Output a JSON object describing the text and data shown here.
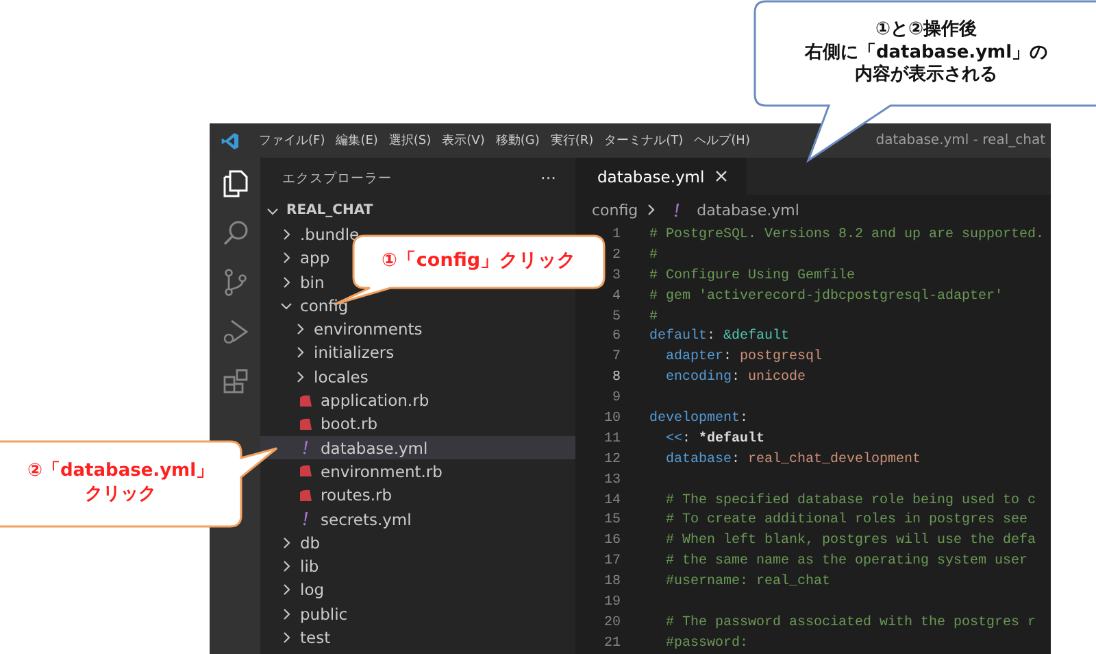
{
  "callouts": [
    {
      "kind": "red",
      "lines": [
        "①「config」クリック"
      ]
    },
    {
      "kind": "orange",
      "lines": [
        "②「database.yml」",
        "クリック"
      ]
    },
    {
      "kind": "blue",
      "lines": [
        "①と②操作後",
        "右側に「database.yml」の",
        "内容が表示される"
      ]
    }
  ],
  "window": {
    "menu": [
      "ファイル(F)",
      "編集(E)",
      "選択(S)",
      "表示(V)",
      "移動(G)",
      "実行(R)",
      "ターミナル(T)",
      "ヘルプ(H)"
    ],
    "title": "database.yml - real_chat"
  },
  "sidebar": {
    "title": "エクスプローラー",
    "more": "···",
    "root": {
      "label": "REAL_CHAT",
      "expanded": true
    },
    "items": [
      {
        "kind": "folder",
        "label": ".bundle",
        "expanded": false,
        "selected": false
      },
      {
        "kind": "folder",
        "label": "app",
        "expanded": false,
        "selected": false
      },
      {
        "kind": "folder",
        "label": "bin",
        "expanded": false,
        "selected": false
      },
      {
        "kind": "folder",
        "label": "config",
        "expanded": true,
        "selected": false,
        "children": [
          {
            "kind": "folder",
            "label": "environments",
            "expanded": false,
            "selected": false
          },
          {
            "kind": "folder",
            "label": "initializers",
            "expanded": false,
            "selected": false
          },
          {
            "kind": "folder",
            "label": "locales",
            "expanded": false,
            "selected": false
          },
          {
            "kind": "ruby",
            "label": "application.rb",
            "selected": false
          },
          {
            "kind": "ruby",
            "label": "boot.rb",
            "selected": false
          },
          {
            "kind": "yaml",
            "label": "database.yml",
            "selected": true
          },
          {
            "kind": "ruby",
            "label": "environment.rb",
            "selected": false
          },
          {
            "kind": "ruby",
            "label": "routes.rb",
            "selected": false
          },
          {
            "kind": "yaml",
            "label": "secrets.yml",
            "selected": false
          }
        ]
      },
      {
        "kind": "folder",
        "label": "db",
        "expanded": false,
        "selected": false
      },
      {
        "kind": "folder",
        "label": "lib",
        "expanded": false,
        "selected": false
      },
      {
        "kind": "folder",
        "label": "log",
        "expanded": false,
        "selected": false
      },
      {
        "kind": "folder",
        "label": "public",
        "expanded": false,
        "selected": false
      },
      {
        "kind": "folder",
        "label": "test",
        "expanded": false,
        "selected": false
      }
    ]
  },
  "editor": {
    "tabs": [
      {
        "label": "database.yml",
        "selected": true
      }
    ],
    "breadcrumb": [
      "config",
      "database.yml"
    ],
    "lines": [
      {
        "number": "1",
        "active": false,
        "tokens": [
          {
            "kind": "comment",
            "text": "# PostgreSQL. Versions 8.2 and up are supported."
          }
        ]
      },
      {
        "number": "2",
        "active": false,
        "tokens": [
          {
            "kind": "comment",
            "text": "#"
          }
        ]
      },
      {
        "number": "3",
        "active": false,
        "tokens": [
          {
            "kind": "comment",
            "text": "# Configure Using Gemfile"
          }
        ]
      },
      {
        "number": "4",
        "active": false,
        "tokens": [
          {
            "kind": "comment",
            "text": "# gem 'activerecord-jdbcpostgresql-adapter'"
          }
        ]
      },
      {
        "number": "5",
        "active": false,
        "tokens": [
          {
            "kind": "comment",
            "text": "#"
          }
        ]
      },
      {
        "number": "6",
        "active": false,
        "tokens": [
          {
            "kind": "key",
            "text": "default"
          },
          {
            "kind": "plain",
            "text": ": "
          },
          {
            "kind": "anchor",
            "text": "&default"
          }
        ]
      },
      {
        "number": "7",
        "active": false,
        "tokens": [
          {
            "kind": "key",
            "text": "  adapter"
          },
          {
            "kind": "plain",
            "text": ": "
          },
          {
            "kind": "value",
            "text": "postgresql"
          }
        ]
      },
      {
        "number": "8",
        "active": true,
        "tokens": [
          {
            "kind": "key",
            "text": "  encoding"
          },
          {
            "kind": "plain",
            "text": ": "
          },
          {
            "kind": "value",
            "text": "unicode"
          }
        ]
      },
      {
        "number": "9",
        "active": false
      },
      {
        "number": "10",
        "active": false,
        "tokens": [
          {
            "kind": "key",
            "text": "development"
          },
          {
            "kind": "plain",
            "text": ":"
          }
        ]
      },
      {
        "number": "11",
        "active": false,
        "tokens": [
          {
            "kind": "key",
            "text": "  <<"
          },
          {
            "kind": "plain",
            "text": ": "
          },
          {
            "kind": "alias",
            "text": "*default"
          }
        ]
      },
      {
        "number": "12",
        "active": false,
        "tokens": [
          {
            "kind": "key",
            "text": "  database"
          },
          {
            "kind": "plain",
            "text": ": "
          },
          {
            "kind": "value",
            "text": "real_chat_development"
          }
        ]
      },
      {
        "number": "13",
        "active": false
      },
      {
        "number": "14",
        "active": false,
        "tokens": [
          {
            "kind": "comment",
            "text": "  # The specified database role being used to c"
          }
        ]
      },
      {
        "number": "15",
        "active": false,
        "tokens": [
          {
            "kind": "comment",
            "text": "  # To create additional roles in postgres see"
          }
        ]
      },
      {
        "number": "16",
        "active": false,
        "tokens": [
          {
            "kind": "comment",
            "text": "  # When left blank, postgres will use the defa"
          }
        ]
      },
      {
        "number": "17",
        "active": false,
        "tokens": [
          {
            "kind": "comment",
            "text": "  # the same name as the operating system user"
          }
        ]
      },
      {
        "number": "18",
        "active": false,
        "tokens": [
          {
            "kind": "comment",
            "text": "  #username: real_chat"
          }
        ]
      },
      {
        "number": "19",
        "active": false
      },
      {
        "number": "20",
        "active": false,
        "tokens": [
          {
            "kind": "comment",
            "text": "  # The password associated with the postgres r"
          }
        ]
      },
      {
        "number": "21",
        "active": false,
        "tokens": [
          {
            "kind": "comment",
            "text": "  #password:"
          }
        ]
      }
    ]
  }
}
